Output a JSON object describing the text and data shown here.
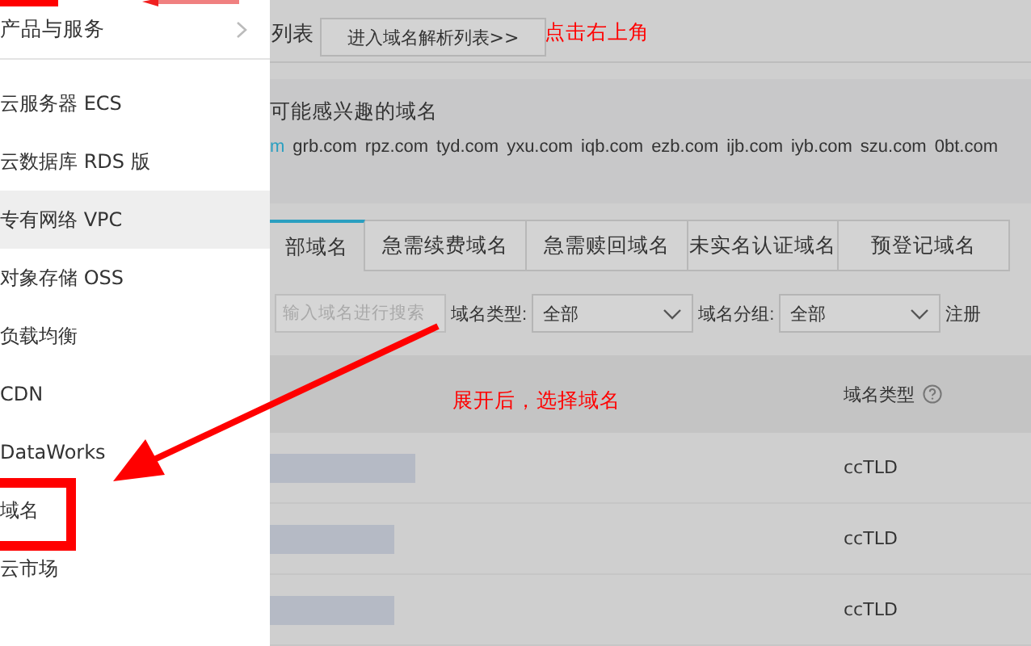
{
  "menu": {
    "title": "产品与服务",
    "items": [
      {
        "label": "云服务器 ECS",
        "hovered": false
      },
      {
        "label": "云数据库 RDS 版",
        "hovered": false
      },
      {
        "label": "专有网络 VPC",
        "hovered": true
      },
      {
        "label": "对象存储 OSS",
        "hovered": false
      },
      {
        "label": "负载均衡",
        "hovered": false
      },
      {
        "label": "CDN",
        "hovered": false
      },
      {
        "label": "DataWorks",
        "hovered": false
      },
      {
        "label": "域名",
        "hovered": false
      },
      {
        "label": "云市场",
        "hovered": false
      }
    ]
  },
  "header": {
    "title": "列表",
    "button": "进入域名解析列表>>"
  },
  "suggestions": {
    "title": "可能感兴趣的域名",
    "domains": [
      {
        "label": "m",
        "color": "#2a9fc0"
      },
      {
        "label": "grb.com",
        "color": "#333333"
      },
      {
        "label": "rpz.com",
        "color": "#333333"
      },
      {
        "label": "tyd.com",
        "color": "#333333"
      },
      {
        "label": "yxu.com",
        "color": "#333333"
      },
      {
        "label": "iqb.com",
        "color": "#333333"
      },
      {
        "label": "ezb.com",
        "color": "#333333"
      },
      {
        "label": "ijb.com",
        "color": "#333333"
      },
      {
        "label": "iyb.com",
        "color": "#333333"
      },
      {
        "label": "szu.com",
        "color": "#333333"
      },
      {
        "label": "0bt.com",
        "color": "#333333"
      }
    ]
  },
  "tabs": [
    {
      "label": "部域名",
      "selected": true
    },
    {
      "label": "急需续费域名",
      "selected": false
    },
    {
      "label": "急需赎回域名",
      "selected": false
    },
    {
      "label": "未实名认证域名",
      "selected": false
    },
    {
      "label": "预登记域名",
      "selected": false
    }
  ],
  "filters": {
    "search": {
      "placeholder": "输入域名进行搜索"
    },
    "selects": [
      {
        "label": "域名类型:",
        "value": "全部"
      },
      {
        "label": "域名分组:",
        "value": "全部"
      }
    ],
    "trailing_label": "注册"
  },
  "table": {
    "columns": [
      {
        "label": "域名类型"
      }
    ],
    "rows": [
      {
        "domain_type": "ccTLD"
      },
      {
        "domain_type": "ccTLD"
      },
      {
        "domain_type": "ccTLD"
      }
    ]
  },
  "annotations": [
    {
      "kind": "note",
      "text": "点击右上角"
    },
    {
      "kind": "note",
      "text": "展开后，选择域名"
    }
  ]
}
